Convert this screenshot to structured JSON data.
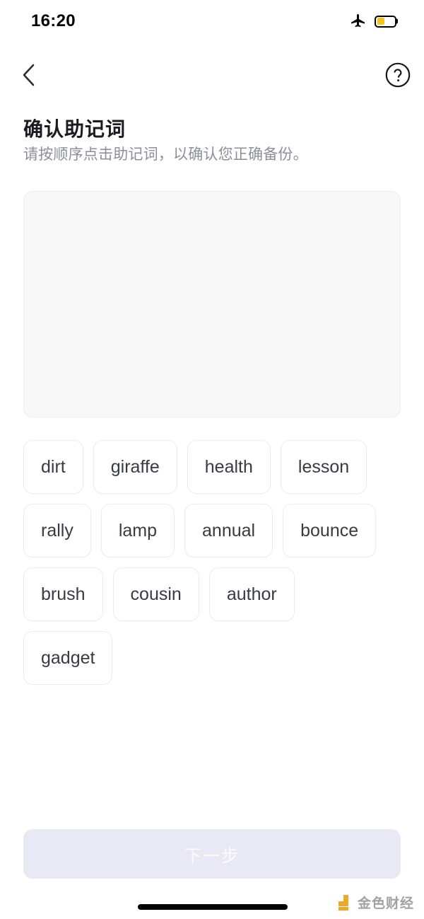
{
  "status_bar": {
    "time": "16:20",
    "airplane_icon": "airplane-icon",
    "battery_icon": "battery-icon",
    "battery_level_percent": 45
  },
  "nav": {
    "back_icon": "chevron-left-icon",
    "help_icon": "question-circle-icon"
  },
  "header": {
    "title": "确认助记词",
    "subtitle": "请按顺序点击助记词，以确认您正确备份。"
  },
  "answer_area": {
    "selected_words": [],
    "placeholder": ""
  },
  "word_pool": {
    "words": [
      "dirt",
      "giraffe",
      "health",
      "lesson",
      "rally",
      "lamp",
      "annual",
      "bounce",
      "brush",
      "cousin",
      "author",
      "gadget"
    ]
  },
  "footer": {
    "next_label": "下一步",
    "next_enabled": false
  },
  "watermark": {
    "text": "金色财经",
    "logo_color": "#e8a317"
  },
  "colors": {
    "accent_disabled": "#e9e9f6",
    "battery_fill": "#f5c518",
    "text_primary": "#1b1b20",
    "text_secondary": "#8e8e99",
    "chip_border": "#ededf0",
    "answer_box_bg": "#f8f8f9"
  }
}
